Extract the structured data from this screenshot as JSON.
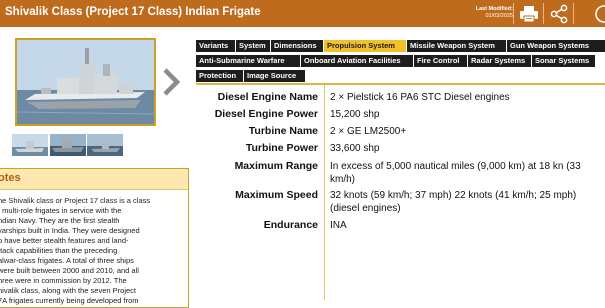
{
  "header": {
    "title": "Shivalik Class (Project 17 Class) Indian Frigate",
    "last_modified_label": "Last Modified:",
    "last_modified_date": "01/03/2025",
    "buttons": [
      {
        "icon": "printer-icon"
      },
      {
        "icon": "share-icon"
      }
    ],
    "colors": {
      "bar": "#bf6b1e",
      "accent": "#f2c02a"
    }
  },
  "notes": {
    "title": "otes",
    "lines": [
      "he Shivalik class or Project 17 class is a class",
      "f multi-role frigates in service with the",
      "ndian Navy. They are the first stealth",
      "varships built in India. They were designed",
      "o have better stealth features and land-",
      "ttack capabilities than the preceding",
      "alwar-class frigates. A total of three ships",
      "were built between 2000 and 2010, and all",
      "hree were in commission by 2012. The",
      "hivalik class, along with the seven Project",
      "7A frigates currently being developed from"
    ]
  },
  "tabs": [
    {
      "label": "Variants",
      "active": false
    },
    {
      "label": "System",
      "active": false
    },
    {
      "label": "Dimensions",
      "active": false
    },
    {
      "label": "Propulsion System",
      "active": true
    },
    {
      "label": "Missile Weapon System",
      "active": false
    },
    {
      "label": "Gun Weapon Systems",
      "active": false
    },
    {
      "label": "Anti-Submarine Warfare",
      "active": false
    },
    {
      "label": "Onboard Aviation Facilities",
      "active": false
    },
    {
      "label": "Fire Control",
      "active": false
    },
    {
      "label": "Radar Systems",
      "active": false
    },
    {
      "label": "Sonar Systems",
      "active": false
    },
    {
      "label": "Protection",
      "active": false
    },
    {
      "label": "Image Source",
      "active": false
    }
  ],
  "specs": [
    {
      "label": "Diesel Engine Name",
      "value": "2 × Pielstick 16 PA6 STC Diesel engines"
    },
    {
      "label": "Diesel Engine Power",
      "value": "15,200 shp"
    },
    {
      "label": "Turbine Name",
      "value": "2 × GE LM2500+"
    },
    {
      "label": "Turbine Power",
      "value": "33,600 shp"
    },
    {
      "label": "Maximum Range",
      "value": "In excess of 5,000 nautical miles (9,000 km) at 18 kn (33 km/h)"
    },
    {
      "label": "Maximum Speed",
      "value": "32 knots (59 km/h; 37 mph) 22 knots (41 km/h; 25 mph) (diesel engines)"
    },
    {
      "label": "Endurance",
      "value": "INA"
    }
  ]
}
